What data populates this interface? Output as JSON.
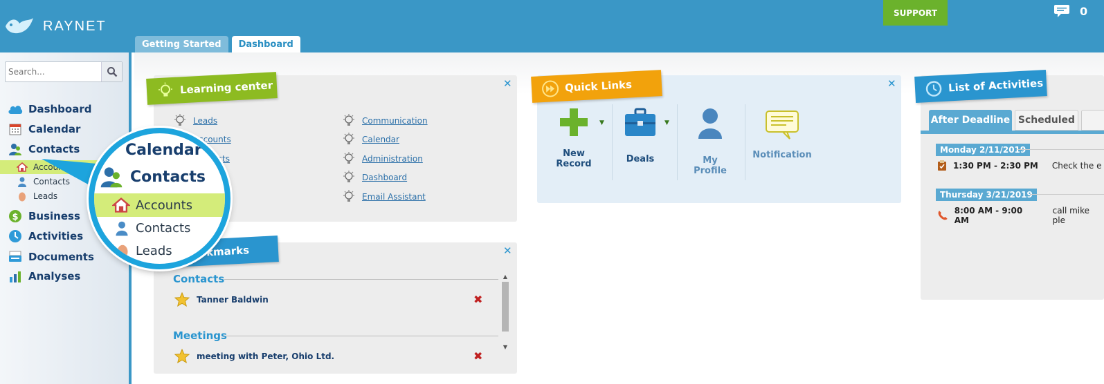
{
  "header": {
    "logo_text": "RAYNET",
    "support_label": "SUPPORT",
    "message_count": "0",
    "tabs": [
      {
        "label": "Getting Started",
        "active": false
      },
      {
        "label": "Dashboard",
        "active": true
      }
    ]
  },
  "sidebar": {
    "search_placeholder": "Search...",
    "items": [
      {
        "label": "Dashboard",
        "icon": "cloud-icon"
      },
      {
        "label": "Calendar",
        "icon": "calendar-icon"
      },
      {
        "label": "Contacts",
        "icon": "contacts-icon"
      },
      {
        "label": "Business",
        "icon": "dollar-icon"
      },
      {
        "label": "Activities",
        "icon": "activities-icon"
      },
      {
        "label": "Documents",
        "icon": "documents-icon"
      },
      {
        "label": "Analyses",
        "icon": "analyses-icon"
      }
    ],
    "sub_items": [
      {
        "label": "Accounts",
        "icon": "house-icon",
        "selected": true
      },
      {
        "label": "Contacts",
        "icon": "person-icon",
        "selected": false
      },
      {
        "label": "Leads",
        "icon": "egg-icon",
        "selected": false
      }
    ]
  },
  "magnifier": {
    "calendar": "Calendar",
    "contacts": "Contacts",
    "accounts": "Accounts",
    "contacts_sub": "Contacts",
    "leads": "Leads"
  },
  "learning_center": {
    "title": "Learning center",
    "links_left": [
      "Leads",
      "Accounts",
      "Contacts"
    ],
    "links_right": [
      "Communication",
      "Calendar",
      "Administration",
      "Dashboard",
      "Email Assistant"
    ]
  },
  "bookmarks": {
    "title": "Bookmarks",
    "groups": [
      {
        "heading": "Contacts",
        "items": [
          "Tanner Baldwin"
        ]
      },
      {
        "heading": "Meetings",
        "items": [
          "meeting with Peter, Ohio Ltd."
        ]
      }
    ]
  },
  "quick_links": {
    "title": "Quick Links",
    "items": [
      {
        "label_line1": "New",
        "label_line2": "Record",
        "icon": "plus-icon"
      },
      {
        "label_line1": "Deals",
        "label_line2": "",
        "icon": "briefcase-icon"
      },
      {
        "label_line1": "My Profile",
        "label_line2": "",
        "icon": "profile-icon"
      },
      {
        "label_line1": "Notification",
        "label_line2": "",
        "icon": "notification-icon"
      }
    ]
  },
  "activities": {
    "title": "List of Activities",
    "tabs": [
      {
        "label": "After Deadline",
        "active": true
      },
      {
        "label": "Scheduled",
        "active": false
      }
    ],
    "groups": [
      {
        "date": "Monday 2/11/2019",
        "time": "1:30 PM - 2:30 PM",
        "text": "Check the e",
        "icon": "task-icon"
      },
      {
        "date": "Thursday 3/21/2019",
        "time": "8:00 AM - 9:00 AM",
        "text": "call mike ple",
        "icon": "phone-icon"
      }
    ]
  },
  "colors": {
    "header_blue": "#3a97c6",
    "support_green": "#6bb22c",
    "learning_ribbon": "#8dbb21",
    "quicklinks_ribbon": "#f2a20c",
    "activities_ribbon": "#2a95cf",
    "selected_item": "#d4ec7a"
  }
}
